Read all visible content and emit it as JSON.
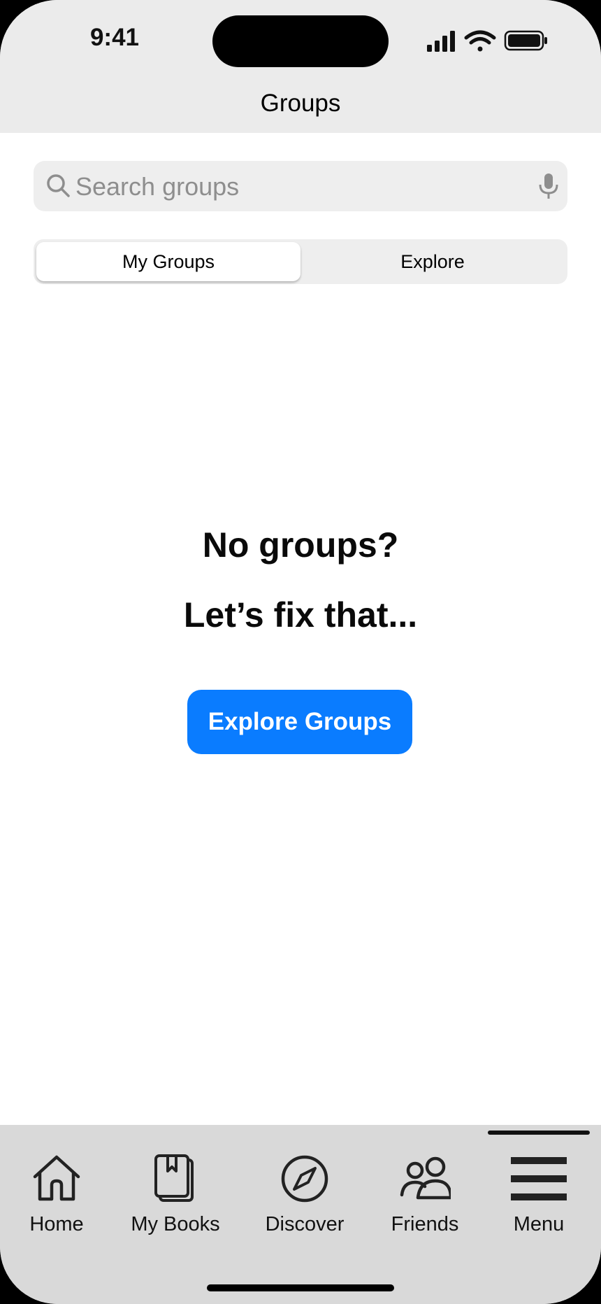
{
  "status": {
    "time": "9:41"
  },
  "nav": {
    "title": "Groups"
  },
  "search": {
    "placeholder": "Search groups",
    "value": ""
  },
  "segmented": {
    "options": [
      "My Groups",
      "Explore"
    ],
    "selected": "My Groups"
  },
  "empty_state": {
    "line1": "No groups?",
    "line2": "Let’s fix that...",
    "button": "Explore Groups"
  },
  "tabbar": {
    "items": [
      {
        "label": "Home",
        "icon": "home-icon"
      },
      {
        "label": "My Books",
        "icon": "books-icon"
      },
      {
        "label": "Discover",
        "icon": "compass-icon"
      },
      {
        "label": "Friends",
        "icon": "friends-icon"
      },
      {
        "label": "Menu",
        "icon": "menu-icon"
      }
    ],
    "active": "Menu"
  },
  "colors": {
    "accent": "#0a7cff",
    "header_bg": "#ebebeb",
    "tabbar_bg": "#d9d9d9",
    "search_bg": "#eeeeee"
  }
}
